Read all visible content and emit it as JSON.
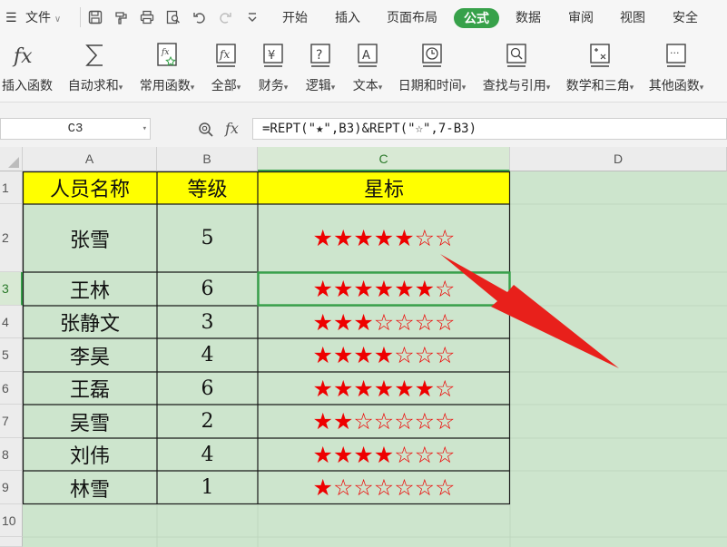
{
  "menu": {
    "file_label": "文件",
    "tabs": [
      {
        "label": "开始",
        "active": false
      },
      {
        "label": "插入",
        "active": false
      },
      {
        "label": "页面布局",
        "active": false
      },
      {
        "label": "公式",
        "active": true
      },
      {
        "label": "数据",
        "active": false
      },
      {
        "label": "审阅",
        "active": false
      },
      {
        "label": "视图",
        "active": false
      },
      {
        "label": "安全",
        "active": false
      }
    ]
  },
  "ribbon": {
    "items": [
      {
        "label": "插入函数",
        "icon": "fx-icon"
      },
      {
        "label": "自动求和",
        "icon": "sigma-icon"
      },
      {
        "label": "常用函数",
        "icon": "common-function-icon"
      },
      {
        "label": "全部",
        "icon": "all-functions-icon"
      },
      {
        "label": "财务",
        "icon": "finance-icon"
      },
      {
        "label": "逻辑",
        "icon": "logic-icon"
      },
      {
        "label": "文本",
        "icon": "text-icon"
      },
      {
        "label": "日期和时间",
        "icon": "datetime-icon"
      },
      {
        "label": "查找与引用",
        "icon": "lookup-icon"
      },
      {
        "label": "数学和三角",
        "icon": "math-icon"
      },
      {
        "label": "其他函数",
        "icon": "other-functions-icon"
      }
    ]
  },
  "formula_bar": {
    "name_box": "C3",
    "fx_label": "fx",
    "formula": "=REPT(\"★\",B3)&REPT(\"☆\",7-B3)"
  },
  "sheet": {
    "columns": [
      "A",
      "B",
      "C",
      "D"
    ],
    "selected_column": "C",
    "selected_row": "3",
    "rows": [
      "1",
      "2",
      "3",
      "4",
      "5",
      "6",
      "7",
      "8",
      "9",
      "10"
    ],
    "header": {
      "name": "人员名称",
      "level": "等级",
      "stars": "星标"
    },
    "records": [
      {
        "name": "张雪",
        "level": "5",
        "stars": "★★★★★☆☆"
      },
      {
        "name": "王林",
        "level": "6",
        "stars": "★★★★★★☆"
      },
      {
        "name": "张静文",
        "level": "3",
        "stars": "★★★☆☆☆☆"
      },
      {
        "name": "李昊",
        "level": "4",
        "stars": "★★★★☆☆☆"
      },
      {
        "name": "王磊",
        "level": "6",
        "stars": "★★★★★★☆"
      },
      {
        "name": "吴雪",
        "level": "2",
        "stars": "★★☆☆☆☆☆"
      },
      {
        "name": "刘伟",
        "level": "4",
        "stars": "★★★★☆☆☆"
      },
      {
        "name": "林雪",
        "level": "1",
        "stars": "★☆☆☆☆☆☆"
      }
    ],
    "header_fill": "#ffff00",
    "star_color": "#ee0000",
    "sheet_background": "#cde5cd",
    "accent": "#37a14a"
  }
}
